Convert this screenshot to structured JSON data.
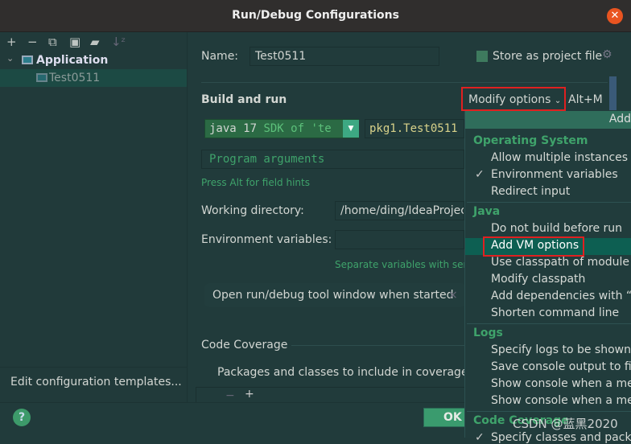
{
  "window": {
    "title": "Run/Debug Configurations"
  },
  "toolbar": {
    "icons": [
      "plus-icon",
      "minus-icon",
      "copy-icon",
      "save-icon",
      "folder-add-icon",
      "sort-icon"
    ]
  },
  "tree": {
    "group": "Application",
    "item": "Test0511"
  },
  "sidebar": {
    "edit_templates": "Edit configuration templates..."
  },
  "form": {
    "name_label": "Name:",
    "name_value": "Test0511",
    "store_label": "Store as project file",
    "build_run": "Build and run",
    "modify_options": "Modify options",
    "modify_shortcut": "Alt+M",
    "jdk_a": "java 17",
    "jdk_b": " SDK of 'te",
    "main_class": "pkg1.Test0511",
    "program_args_placeholder": "Program arguments",
    "hint": "Press Alt for field hints",
    "workdir_label": "Working directory:",
    "workdir_value": "/home/ding/IdeaProjec",
    "env_label": "Environment variables:",
    "env_value": "",
    "env_hint": "Separate variables with semi",
    "open_tool_window": "Open run/debug tool window when started",
    "code_coverage": "Code Coverage",
    "packages_label": "Packages and classes to include in coverage da"
  },
  "footer": {
    "ok": "OK"
  },
  "menu": {
    "header": "Add",
    "groups": [
      {
        "title": "Operating System",
        "items": [
          "Allow multiple instances",
          "Environment variables",
          "Redirect input"
        ],
        "checked": "Environment variables"
      },
      {
        "title": "Java",
        "items": [
          "Do not build before run",
          "Add VM options",
          "Use classpath of module",
          "Modify classpath",
          "Add dependencies with “p",
          "Shorten command line"
        ],
        "selected": "Add VM options"
      },
      {
        "title": "Logs",
        "items": [
          "Specify logs to be shown i",
          "Save console output to file",
          "Show console when a mess",
          "Show console when a mess"
        ]
      },
      {
        "title": "Code Coverage",
        "items": [
          "Specify classes and packa"
        ]
      }
    ]
  },
  "watermark": "CSDN @蓝黑2020",
  "colors": {
    "accent": "#3fa36b",
    "selection": "#0d5f52",
    "highlight_box": "#e02020",
    "close": "#e95420"
  }
}
